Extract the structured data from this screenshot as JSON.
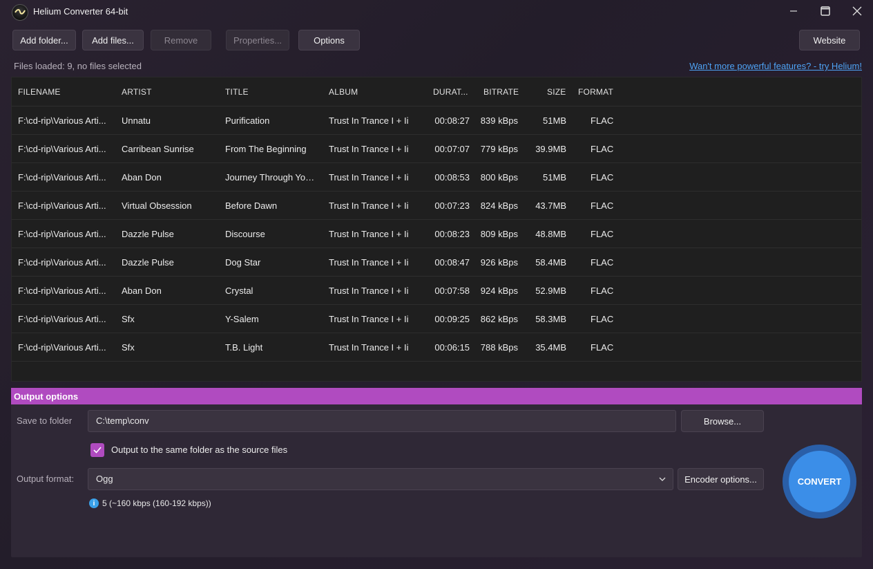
{
  "window": {
    "title": "Helium Converter 64-bit"
  },
  "toolbar": {
    "add_folder": "Add folder...",
    "add_files": "Add files...",
    "remove": "Remove",
    "properties": "Properties...",
    "options": "Options",
    "website": "Website"
  },
  "status": {
    "files_loaded": "Files loaded: 9, no files selected",
    "promo": "Wan't more powerful features? - try Helium!"
  },
  "table": {
    "headers": [
      "FILENAME",
      "ARTIST",
      "TITLE",
      "ALBUM",
      "DURAT...",
      "BITRATE",
      "SIZE",
      "FORMAT"
    ],
    "rows": [
      [
        "F:\\cd-rip\\Various Arti...",
        "Unnatu",
        "Purification",
        "Trust In Trance I + Ii",
        "00:08:27",
        "839 kBps",
        "51MB",
        "FLAC"
      ],
      [
        "F:\\cd-rip\\Various Arti...",
        "Carribean Sunrise",
        "From The Beginning",
        "Trust In Trance I + Ii",
        "00:07:07",
        "779 kBps",
        "39.9MB",
        "FLAC"
      ],
      [
        "F:\\cd-rip\\Various Arti...",
        "Aban Don",
        "Journey Through Your...",
        "Trust In Trance I + Ii",
        "00:08:53",
        "800 kBps",
        "51MB",
        "FLAC"
      ],
      [
        "F:\\cd-rip\\Various Arti...",
        "Virtual Obsession",
        "Before Dawn",
        "Trust In Trance I + Ii",
        "00:07:23",
        "824 kBps",
        "43.7MB",
        "FLAC"
      ],
      [
        "F:\\cd-rip\\Various Arti...",
        "Dazzle Pulse",
        "Discourse",
        "Trust In Trance I + Ii",
        "00:08:23",
        "809 kBps",
        "48.8MB",
        "FLAC"
      ],
      [
        "F:\\cd-rip\\Various Arti...",
        "Dazzle Pulse",
        "Dog Star",
        "Trust In Trance I + Ii",
        "00:08:47",
        "926 kBps",
        "58.4MB",
        "FLAC"
      ],
      [
        "F:\\cd-rip\\Various Arti...",
        "Aban Don",
        "Crystal",
        "Trust In Trance I + Ii",
        "00:07:58",
        "924 kBps",
        "52.9MB",
        "FLAC"
      ],
      [
        "F:\\cd-rip\\Various Arti...",
        "Sfx",
        "Y-Salem",
        "Trust In Trance I + Ii",
        "00:09:25",
        "862 kBps",
        "58.3MB",
        "FLAC"
      ],
      [
        "F:\\cd-rip\\Various Arti...",
        "Sfx",
        "T.B. Light",
        "Trust In Trance I + Ii",
        "00:06:15",
        "788 kBps",
        "35.4MB",
        "FLAC"
      ]
    ]
  },
  "output": {
    "header": "Output options",
    "save_label": "Save to folder",
    "save_path": "C:\\temp\\conv",
    "browse": "Browse...",
    "same_folder_label": "Output to the same folder as the source files",
    "same_folder_checked": true,
    "format_label": "Output format:",
    "format_value": "Ogg",
    "encoder_options": "Encoder options...",
    "quality_info": "5 (~160 kbps (160-192 kbps))",
    "convert": "CONVERT"
  },
  "colors": {
    "accent": "#b04bc0",
    "convert": "#3b8ee8",
    "link": "#4ea3f5"
  }
}
